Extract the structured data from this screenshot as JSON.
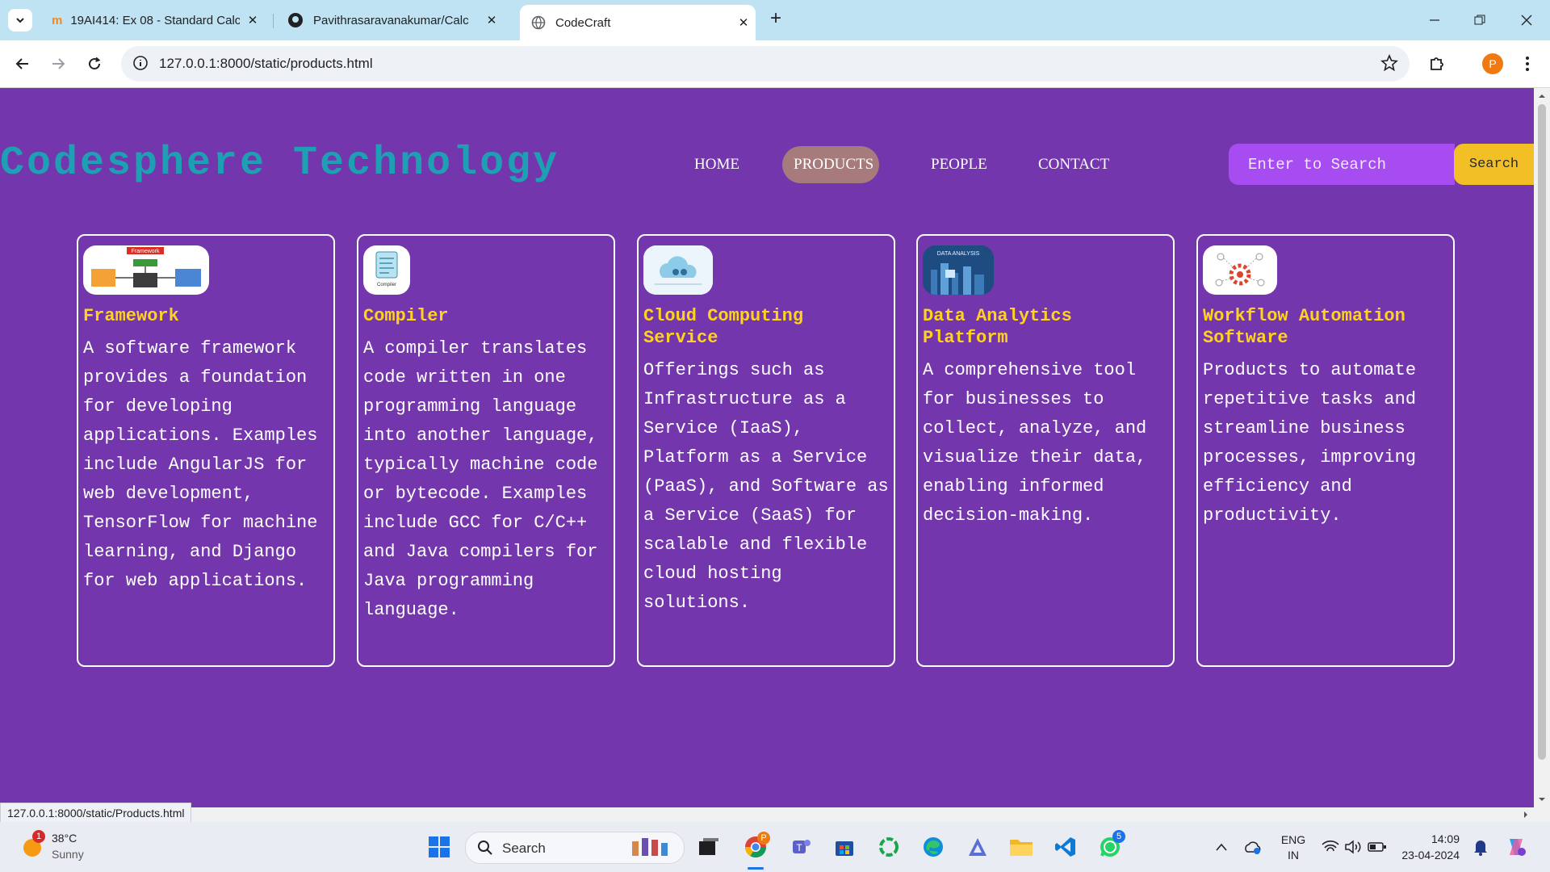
{
  "browser": {
    "tabs": [
      {
        "title": "19AI414: Ex 08 - Standard Calc",
        "favicon": "moodle-icon"
      },
      {
        "title": "Pavithrasaravanakumar/Calc",
        "favicon": "github-icon"
      },
      {
        "title": "CodeCraft",
        "favicon": "globe-icon",
        "active": true
      }
    ],
    "url": "127.0.0.1:8000/static/products.html",
    "profile_initial": "P",
    "status_url": "127.0.0.1:8000/static/Products.html"
  },
  "site": {
    "title": "Codesphere Technology",
    "nav": [
      "HOME",
      "PRODUCTS",
      "PEOPLE",
      "CONTACT"
    ],
    "active_nav": "PRODUCTS",
    "search_placeholder": "Enter to Search",
    "search_button": "Search",
    "colors": {
      "background": "#7436ad",
      "title": "#1e9fb3",
      "card_title": "#ffd21f",
      "search_bg": "#a64cf0",
      "search_button": "#f2c026",
      "active_nav": "#a77b7b"
    }
  },
  "products": [
    {
      "title": "Framework",
      "thumb_label": "Framework",
      "desc": "A software framework provides a foundation for developing applications. Examples include AngularJS for web development, TensorFlow for machine learning, and Django for web applications."
    },
    {
      "title": "Compiler",
      "thumb_label": "Compiler",
      "desc": "A compiler translates code written in one programming language into another language, typically machine code or bytecode. Examples include GCC for C/C++ and Java compilers for Java programming language."
    },
    {
      "title": "Cloud Computing Service",
      "thumb_label": "",
      "desc": "Offerings such as Infrastructure as a Service (IaaS), Platform as a Service (PaaS), and Software as a Service (SaaS) for scalable and flexible cloud hosting solutions."
    },
    {
      "title": "Data Analytics Platform",
      "thumb_label": "DATA ANALYSIS",
      "desc": "A comprehensive tool for businesses to collect, analyze, and visualize their data, enabling informed decision-making."
    },
    {
      "title": "Workflow Automation Software",
      "thumb_label": "",
      "desc": "Products to automate repetitive tasks and streamline business processes, improving efficiency and productivity."
    }
  ],
  "taskbar": {
    "weather": {
      "temp": "38°C",
      "condition": "Sunny",
      "badge": "1"
    },
    "search_label": "Search",
    "whatsapp_badge": "5",
    "lang": "ENG",
    "region": "IN",
    "time": "14:09",
    "date": "23-04-2024"
  }
}
